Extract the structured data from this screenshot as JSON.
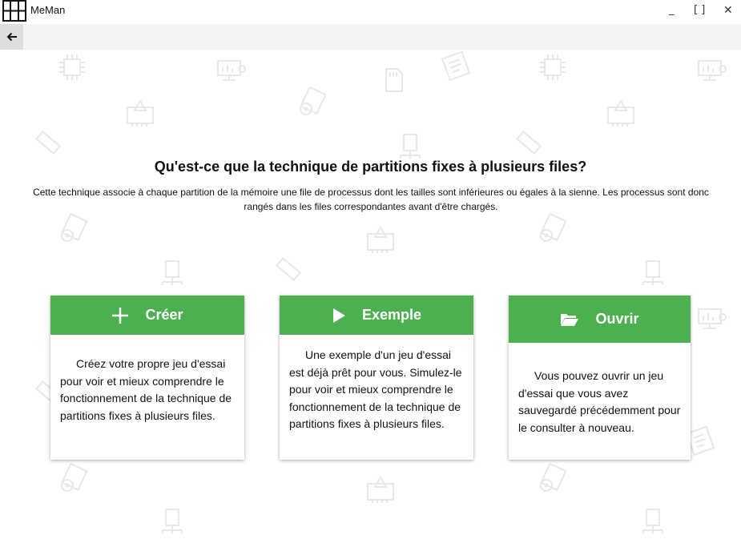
{
  "window": {
    "title": "MeMan",
    "minimize_glyph": "_",
    "maximize_glyph": "[ ]",
    "close_glyph": "✕"
  },
  "nav": {
    "back_icon": "arrow-left-icon"
  },
  "main": {
    "heading": "Qu'est-ce que la technique de partitions fixes à plusieurs files?",
    "description": "Cette technique associe à chaque partition de la mémoire une file de processus dont les tailles sont inférieures ou égales à la sienne. Les processus sont donc rangés dans les files correspondantes avant d'être chargés."
  },
  "cards": [
    {
      "title": "Créer",
      "icon": "plus-icon",
      "text": "Créez votre propre jeu d'essai pour voir et mieux comprendre le fonctionnement de la technique de partitions fixes à plusieurs files."
    },
    {
      "title": "Exemple",
      "icon": "play-icon",
      "text": "Une exemple d'un jeu d'essai est déjà prêt pour vous. Simulez-le pour voir et mieux comprendre le fonctionnement de la technique de partitions fixes à plusieurs files."
    },
    {
      "title": "Ouvrir",
      "icon": "folder-open-icon",
      "text": "Vous pouvez ouvrir un jeu d'essai que vous avez sauvegardé précédemment pour le consulter à nouveau."
    }
  ],
  "colors": {
    "accent": "#4caf50",
    "navbar": "#f4f4f4",
    "back_button": "#dedede"
  }
}
